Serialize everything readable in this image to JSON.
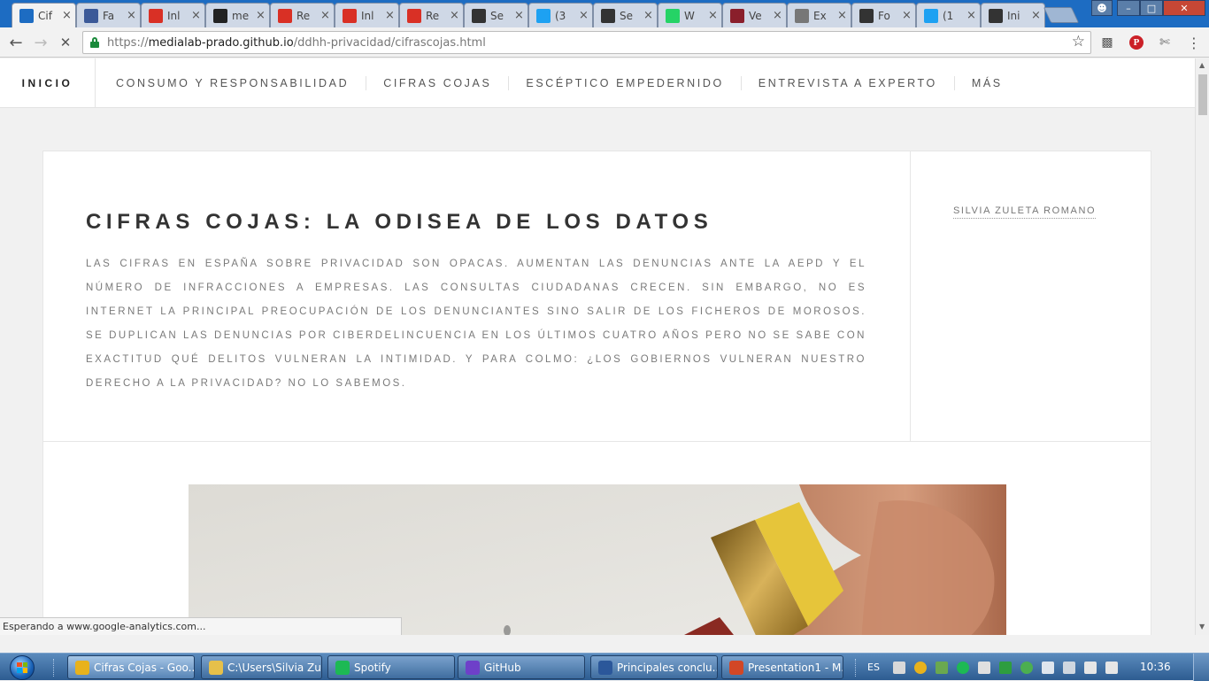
{
  "browser": {
    "tabs": [
      {
        "title": "Cif",
        "favicon": "loading-spinner-icon",
        "color": "#1d6cc2",
        "active": true
      },
      {
        "title": "Fa",
        "favicon": "facebook-icon",
        "color": "#3b5998"
      },
      {
        "title": "Inl",
        "favicon": "gmail-icon",
        "color": "#d93025"
      },
      {
        "title": "me",
        "favicon": "github-icon",
        "color": "#222222"
      },
      {
        "title": "Re",
        "favicon": "gmail-icon",
        "color": "#d93025"
      },
      {
        "title": "Inl",
        "favicon": "gmail-icon",
        "color": "#d93025"
      },
      {
        "title": "Re",
        "favicon": "gmail-icon",
        "color": "#d93025"
      },
      {
        "title": "Se",
        "favicon": "medialab-prado-icon",
        "color": "#333333"
      },
      {
        "title": "(3",
        "favicon": "twitter-icon",
        "color": "#1da1f2"
      },
      {
        "title": "Se",
        "favicon": "medialab-prado-icon",
        "color": "#333333"
      },
      {
        "title": "W",
        "favicon": "whatsapp-icon",
        "color": "#25d366"
      },
      {
        "title": "Ve",
        "favicon": "monitor-icon",
        "color": "#8a1f2b"
      },
      {
        "title": "Ex",
        "favicon": "document-icon",
        "color": "#777777"
      },
      {
        "title": "Fo",
        "favicon": "openai-icon",
        "color": "#333333"
      },
      {
        "title": "(1",
        "favicon": "twitter-icon",
        "color": "#1da1f2"
      },
      {
        "title": "Ini",
        "favicon": "e-letter-icon",
        "color": "#333333"
      }
    ],
    "url": {
      "scheme": "https://",
      "host": "medialab-prado.github.io",
      "path": "/ddhh-privacidad/cifrascojas.html"
    },
    "status_text": "Esperando a www.google-analytics.com..."
  },
  "site": {
    "nav": {
      "home": "INICIO",
      "items": [
        "CONSUMO Y RESPONSABILIDAD",
        "CIFRAS COJAS",
        "ESCÉPTICO EMPEDERNIDO",
        "ENTREVISTA A EXPERTO",
        "MÁS"
      ]
    },
    "article": {
      "title": "CIFRAS COJAS: LA ODISEA DE LOS DATOS",
      "lead": "Las cifras en España sobre privacidad son opacas. Aumentan las denuncias ante la AEPD y el número de infracciones a empresas. Las consultas ciudadanas crecen. Sin embargo, no es Internet la principal preocupación de los denunciantes sino salir de los ficheros de morosos. Se duplican las denuncias por ciberdelincuencia en los últimos cuatro años pero no se sabe con exactitud qué delitos vulneran la intimidad. Y para colmo: ¿Los gobiernos vulneran nuestro derecho a la privacidad? No lo sabemos.",
      "author": "SILVIA ZULETA ROMANO",
      "image": "pencil-eraser-photo"
    }
  },
  "taskbar": {
    "tasks": [
      {
        "label": "Cifras Cojas - Goo...",
        "icon": "chrome-icon",
        "color": "#e8b21c",
        "active": true
      },
      {
        "label": "C:\\Users\\Silvia Zul...",
        "icon": "folder-icon",
        "color": "#e6c04a"
      },
      {
        "label": "Spotify",
        "icon": "spotify-icon",
        "color": "#1db954"
      },
      {
        "label": "GitHub",
        "icon": "github-desktop-icon",
        "color": "#6e40c9"
      },
      {
        "label": "Principales conclu...",
        "icon": "word-icon",
        "color": "#2b579a"
      },
      {
        "label": "Presentation1 - M...",
        "icon": "powerpoint-icon",
        "color": "#d24726"
      }
    ],
    "language": "ES",
    "clock": "10:36"
  }
}
